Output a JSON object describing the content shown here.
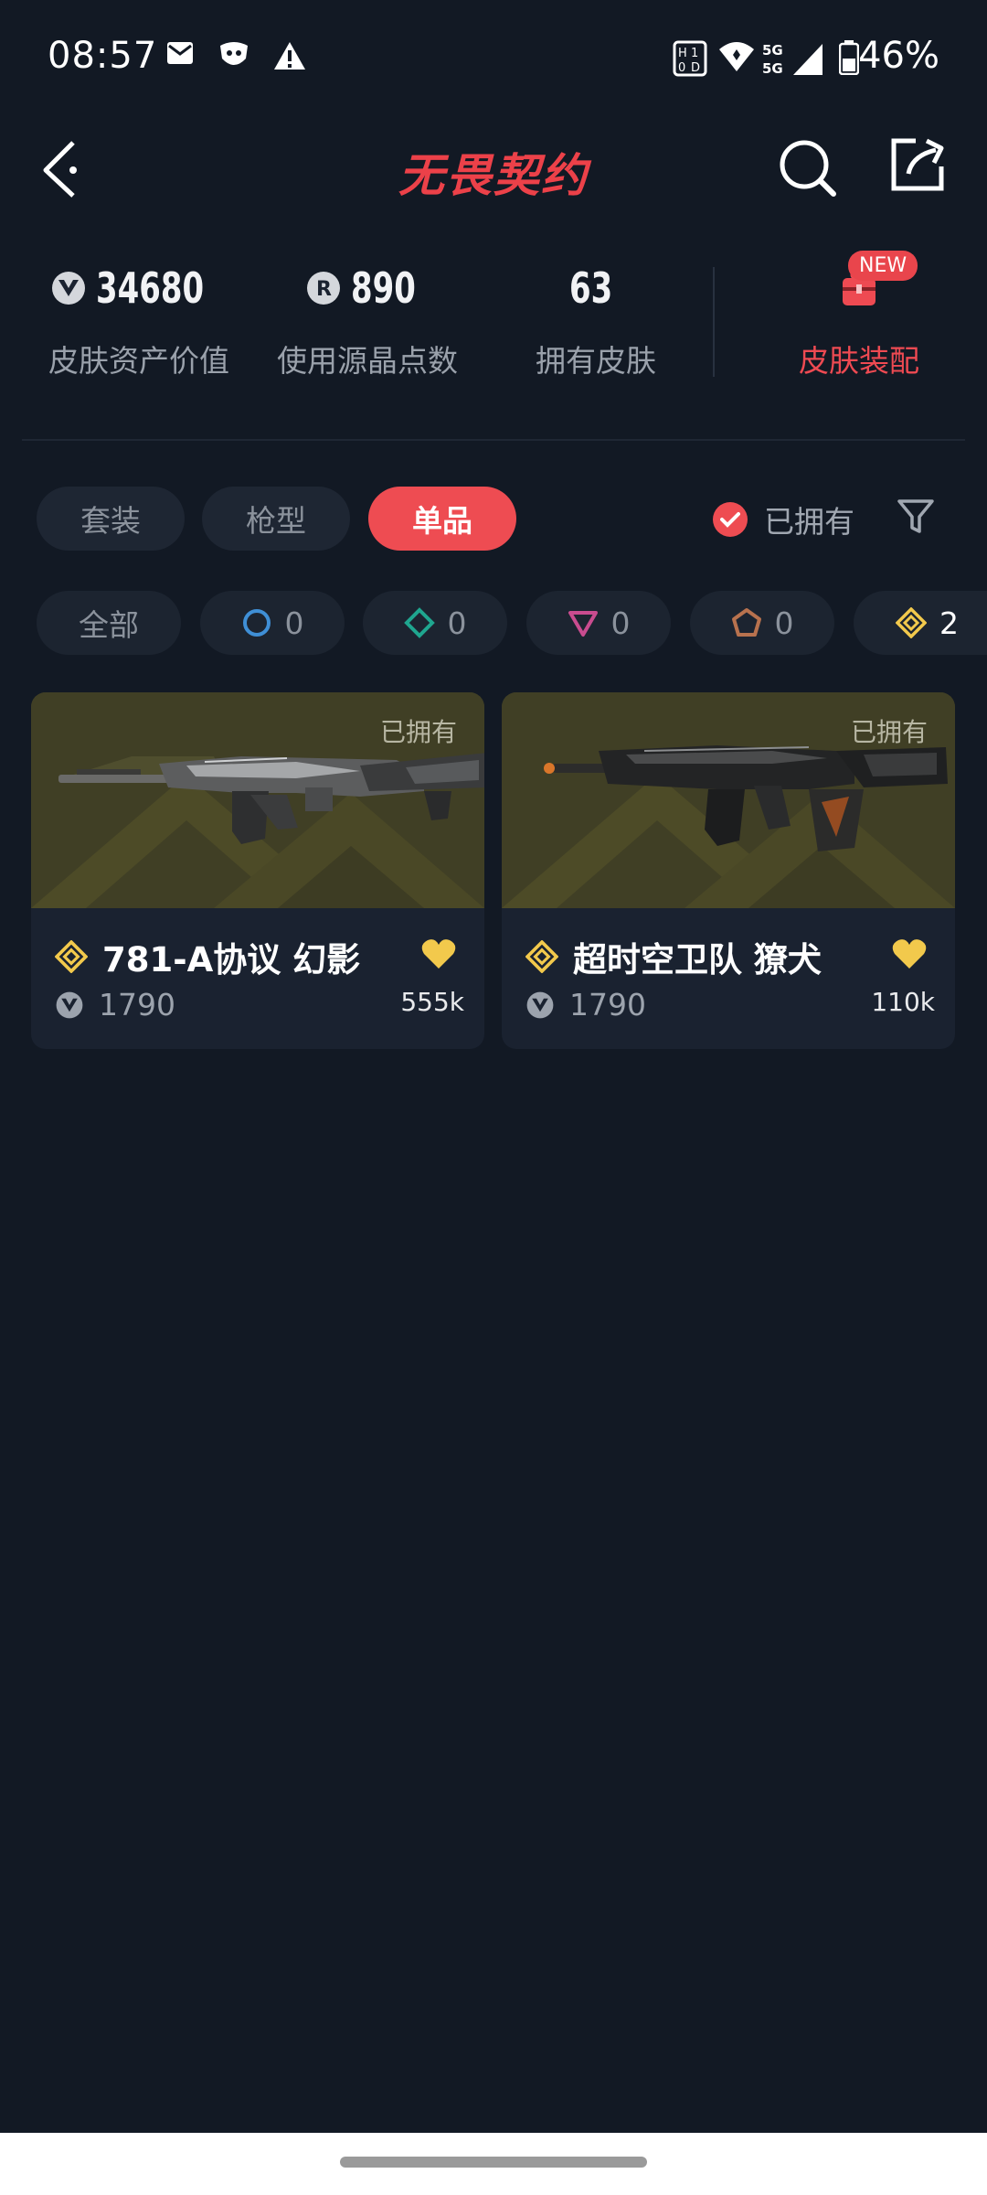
{
  "status_bar": {
    "time": "08:57",
    "battery": "46%",
    "network": "5G",
    "icons": [
      "mail-icon",
      "shield-app-icon",
      "warning-icon",
      "nfc-icon",
      "wifi-icon",
      "5g-signal-icon",
      "battery-icon"
    ]
  },
  "header": {
    "title": "无畏契约",
    "icons": [
      "back-icon",
      "search-icon",
      "share-icon"
    ]
  },
  "stats": [
    {
      "value": "34680",
      "label": "皮肤资产价值",
      "icon": "vp-coin-icon"
    },
    {
      "value": "890",
      "label": "使用源晶点数",
      "icon": "radianite-icon"
    },
    {
      "value": "63",
      "label": "拥有皮肤"
    }
  ],
  "outfit": {
    "label": "皮肤装配",
    "badge": "NEW",
    "icon": "backpack-icon"
  },
  "tabs": [
    {
      "label": "套装"
    },
    {
      "label": "枪型"
    },
    {
      "label": "单品",
      "active": true
    }
  ],
  "owned_filter": {
    "label": "已拥有",
    "checked": true
  },
  "rarity_chips": [
    {
      "label": "全部"
    },
    {
      "count": "0",
      "icon": "select-tier-icon"
    },
    {
      "count": "0",
      "icon": "deluxe-tier-icon"
    },
    {
      "count": "0",
      "icon": "premium-tier-icon"
    },
    {
      "count": "0",
      "icon": "exclusive-tier-icon"
    },
    {
      "count": "2",
      "icon": "ultra-tier-icon"
    }
  ],
  "cards": [
    {
      "name": "781-A协议 幻影",
      "owned_tag": "已拥有",
      "price": "1790",
      "likes": "555k"
    },
    {
      "name": "超时空卫队 獠犬",
      "owned_tag": "已拥有",
      "price": "1790",
      "likes": "110k"
    }
  ],
  "colors": {
    "background": "#121924",
    "accent": "#ee4c52",
    "card": "#1a2230",
    "gold": "#f2c94c"
  }
}
